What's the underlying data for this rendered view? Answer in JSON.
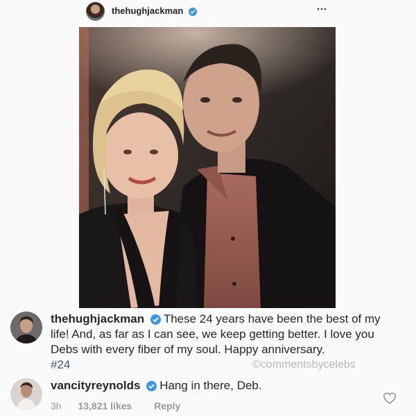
{
  "header": {
    "username": "thehughjackman",
    "verified": true,
    "more_icon": "more-horizontal-icon"
  },
  "post": {
    "image_alt": "photo-of-couple"
  },
  "caption": {
    "username": "thehughjackman",
    "text": "These 24 years have been the best of my life! And, as far as I can see, we keep getting better. I love you Debs with every fiber of my soul. Happy anniversary.",
    "hashtag": "#24",
    "watermark": "©commentsbycelebs"
  },
  "reply": {
    "username": "vancityreynolds",
    "text": "Hang in there, Deb.",
    "time": "3h",
    "likes": "13,821 likes",
    "reply_label": "Reply"
  },
  "colors": {
    "background": "#fafafa",
    "text": "#262626",
    "verified_blue": "#3897f0",
    "hashtag": "#33578a",
    "muted": "#999999"
  },
  "icons": [
    "verified-badge-icon",
    "more-horizontal-icon",
    "heart-icon"
  ]
}
